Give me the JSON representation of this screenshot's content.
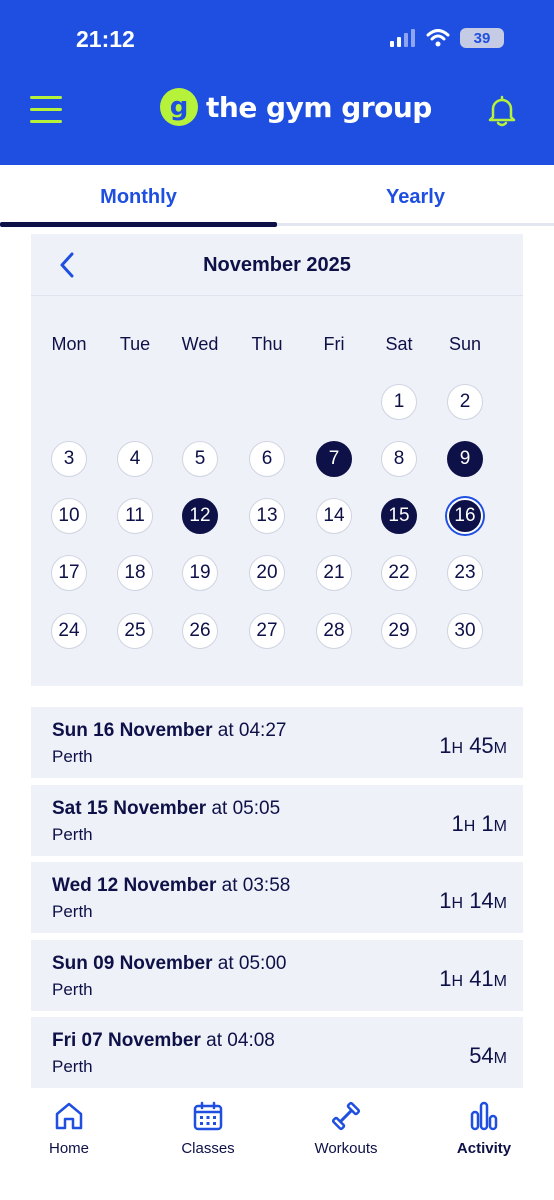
{
  "status": {
    "time": "21:12",
    "battery": "39"
  },
  "header": {
    "brand_mark": "g",
    "brand": "the gym group"
  },
  "tabs": {
    "monthly": "Monthly",
    "yearly": "Yearly"
  },
  "calendar": {
    "title": "November 2025",
    "weekdays": [
      "Mon",
      "Tue",
      "Wed",
      "Thu",
      "Fri",
      "Sat",
      "Sun"
    ],
    "days": [
      {
        "n": "1",
        "state": "normal"
      },
      {
        "n": "2",
        "state": "normal"
      },
      {
        "n": "3",
        "state": "normal"
      },
      {
        "n": "4",
        "state": "normal"
      },
      {
        "n": "5",
        "state": "normal"
      },
      {
        "n": "6",
        "state": "normal"
      },
      {
        "n": "7",
        "state": "visited"
      },
      {
        "n": "8",
        "state": "normal"
      },
      {
        "n": "9",
        "state": "visited"
      },
      {
        "n": "10",
        "state": "normal"
      },
      {
        "n": "11",
        "state": "normal"
      },
      {
        "n": "12",
        "state": "visited"
      },
      {
        "n": "13",
        "state": "normal"
      },
      {
        "n": "14",
        "state": "normal"
      },
      {
        "n": "15",
        "state": "visited"
      },
      {
        "n": "16",
        "state": "today"
      },
      {
        "n": "17",
        "state": "normal"
      },
      {
        "n": "18",
        "state": "normal"
      },
      {
        "n": "19",
        "state": "normal"
      },
      {
        "n": "20",
        "state": "normal"
      },
      {
        "n": "21",
        "state": "normal"
      },
      {
        "n": "22",
        "state": "normal"
      },
      {
        "n": "23",
        "state": "normal"
      },
      {
        "n": "24",
        "state": "normal"
      },
      {
        "n": "25",
        "state": "normal"
      },
      {
        "n": "26",
        "state": "normal"
      },
      {
        "n": "27",
        "state": "normal"
      },
      {
        "n": "28",
        "state": "normal"
      },
      {
        "n": "29",
        "state": "normal"
      },
      {
        "n": "30",
        "state": "normal"
      }
    ]
  },
  "sessions": [
    {
      "date": "Sun 16 November",
      "time": " at 04:27",
      "location": "Perth",
      "hours": "1",
      "minutes": "45"
    },
    {
      "date": "Sat 15 November",
      "time": " at 05:05",
      "location": "Perth",
      "hours": "1",
      "minutes": "1"
    },
    {
      "date": "Wed 12 November",
      "time": " at 03:58",
      "location": "Perth",
      "hours": "1",
      "minutes": "14"
    },
    {
      "date": "Sun 09 November",
      "time": " at 05:00",
      "location": "Perth",
      "hours": "1",
      "minutes": "41"
    },
    {
      "date": "Fri 07 November",
      "time": " at 04:08",
      "location": "Perth",
      "hours": "",
      "minutes": "54"
    }
  ],
  "units": {
    "h": "H",
    "m": "M"
  },
  "nav": {
    "home": "Home",
    "classes": "Classes",
    "workouts": "Workouts",
    "activity": "Activity"
  },
  "colors": {
    "brand_blue": "#1e4fe0",
    "lime": "#b7f23b",
    "navy": "#0e1147"
  }
}
